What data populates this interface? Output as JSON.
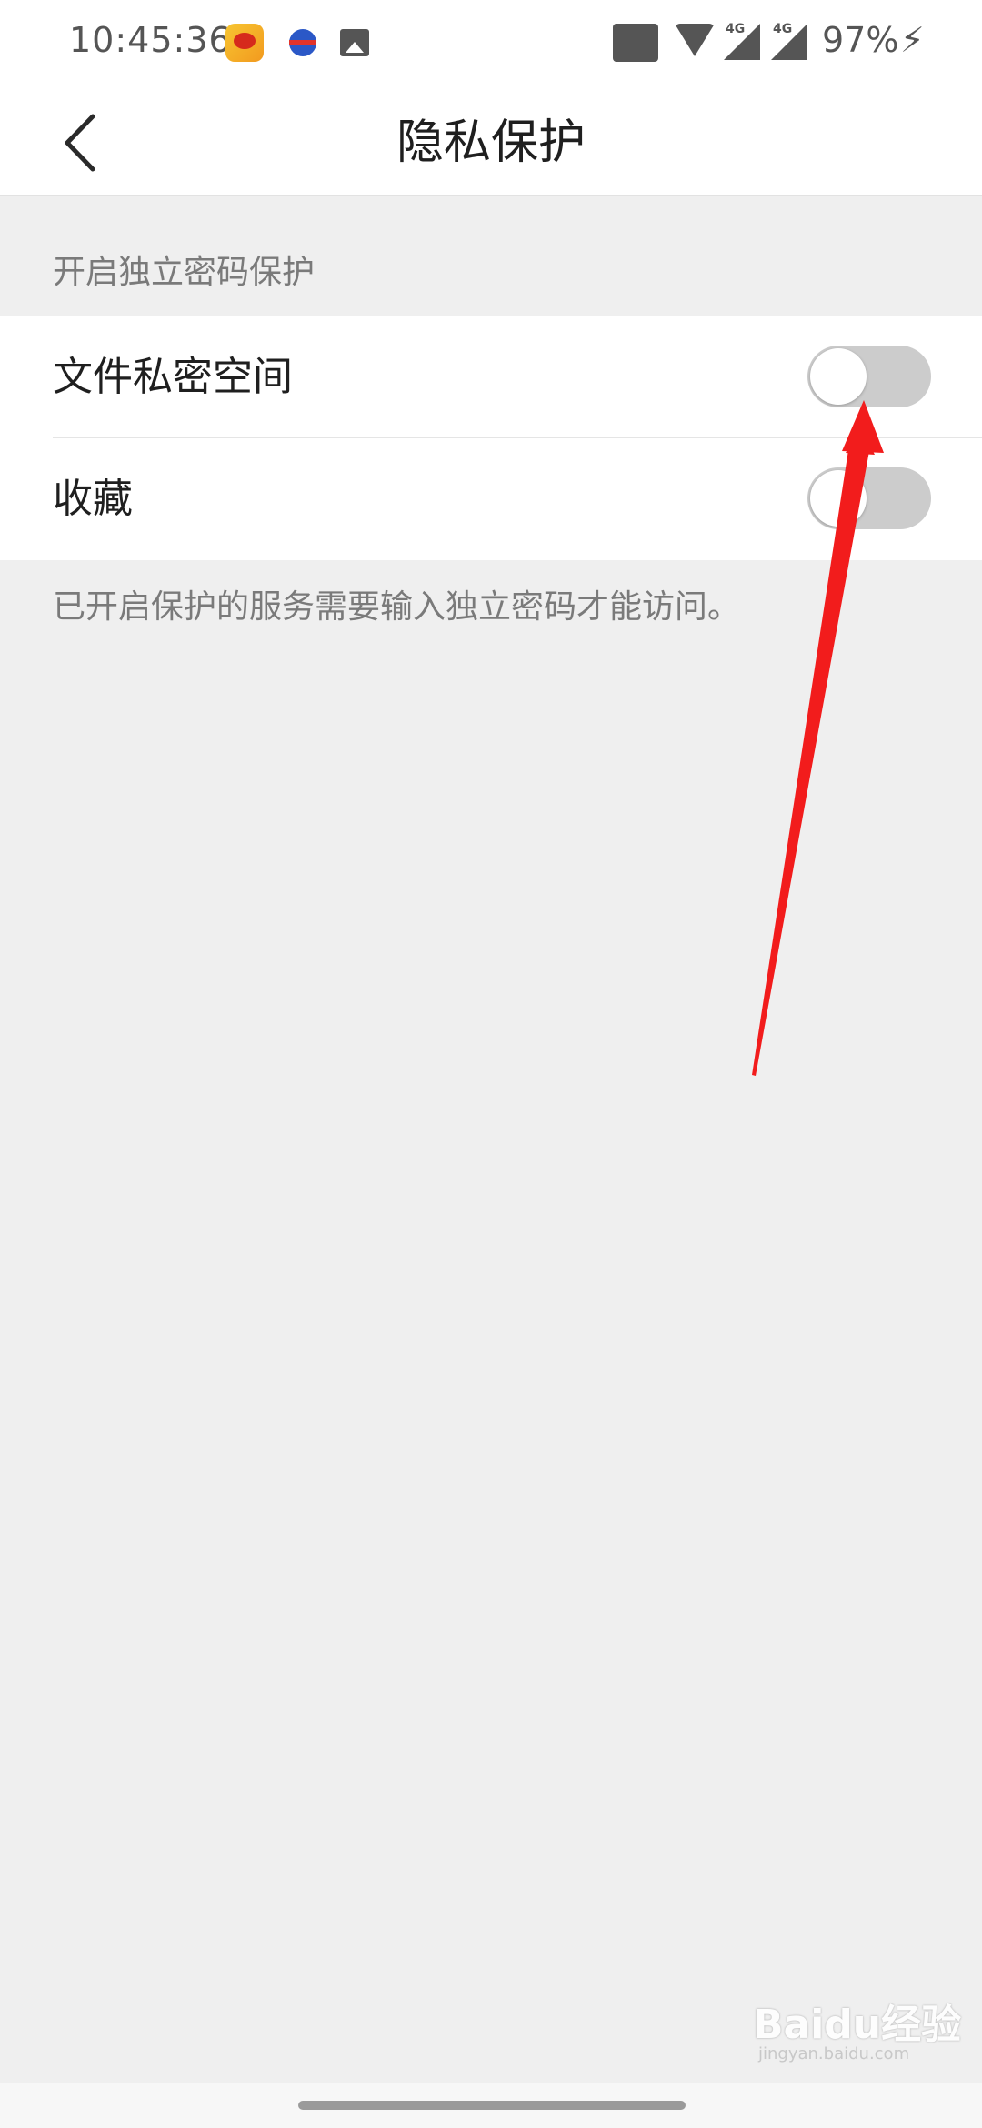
{
  "status_bar": {
    "time": "10:45:36",
    "battery": "97%",
    "network_1": "4G",
    "network_2": "4G",
    "icons": [
      "weibo-icon",
      "sports-app-icon",
      "gallery-icon",
      "volte-icon",
      "wifi-icon",
      "signal-icon",
      "charging-icon"
    ]
  },
  "header": {
    "title": "隐私保护",
    "back_icon": "chevron-left-icon"
  },
  "section": {
    "title": "开启独立密码保护"
  },
  "settings": [
    {
      "label": "文件私密空间",
      "enabled": false
    },
    {
      "label": "收藏",
      "enabled": false
    }
  ],
  "footnote": "已开启保护的服务需要输入独立密码才能访问。",
  "annotation": {
    "type": "arrow",
    "color": "#f21c1c"
  },
  "watermark": {
    "text": "Baidu经验",
    "sub": "jingyan.baidu.com"
  }
}
